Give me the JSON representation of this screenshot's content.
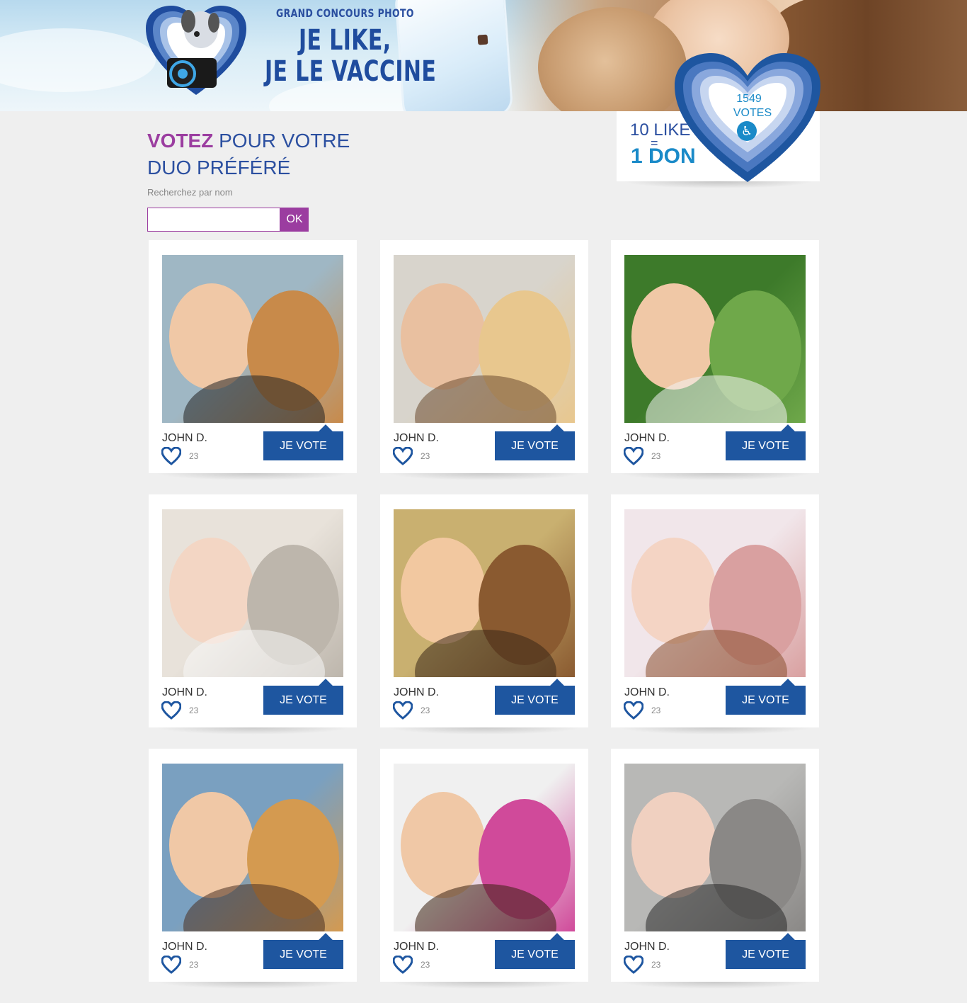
{
  "banner": {
    "contest_title": "GRAND CONCOURS PHOTO",
    "headline_line1": "JE LIKE,",
    "headline_line2": "JE LE VACCINE"
  },
  "heading": {
    "strong": "VOTEZ",
    "rest_line1": " POUR VOTRE",
    "line2": "DUO PRÉFÉRÉ"
  },
  "search": {
    "label": "Recherchez par nom",
    "value": "",
    "placeholder": "",
    "button_label": "OK"
  },
  "counter": {
    "like_line": "10 LIKE",
    "equals": "=",
    "don_line": "1 DON",
    "votes_count": "1549",
    "votes_label": "VOTES"
  },
  "colors": {
    "brand_blue": "#1e56a0",
    "accent_purple": "#9b3da0",
    "accent_cyan": "#1a8ac8",
    "background": "#efefef"
  },
  "cards": [
    {
      "name": "JOHN D.",
      "likes": "23",
      "button": "JE VOTE"
    },
    {
      "name": "JOHN D.",
      "likes": "23",
      "button": "JE VOTE"
    },
    {
      "name": "JOHN D.",
      "likes": "23",
      "button": "JE VOTE"
    },
    {
      "name": "JOHN D.",
      "likes": "23",
      "button": "JE VOTE"
    },
    {
      "name": "JOHN D.",
      "likes": "23",
      "button": "JE VOTE"
    },
    {
      "name": "JOHN D.",
      "likes": "23",
      "button": "JE VOTE"
    },
    {
      "name": "JOHN D.",
      "likes": "23",
      "button": "JE VOTE"
    },
    {
      "name": "JOHN D.",
      "likes": "23",
      "button": "JE VOTE"
    },
    {
      "name": "JOHN D.",
      "likes": "23",
      "button": "JE VOTE"
    }
  ]
}
